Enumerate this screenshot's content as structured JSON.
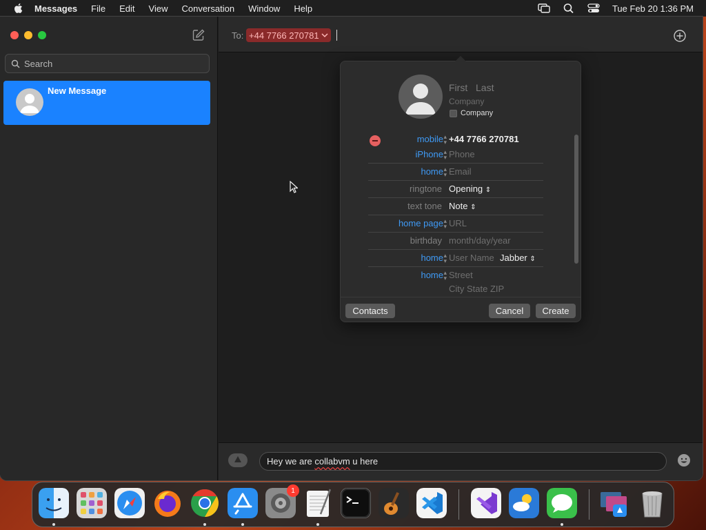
{
  "menubar": {
    "app_name": "Messages",
    "items": [
      "File",
      "Edit",
      "View",
      "Conversation",
      "Window",
      "Help"
    ],
    "datetime": "Tue Feb 20  1:36 PM"
  },
  "sidebar": {
    "search_placeholder": "Search",
    "conversation_title": "New Message"
  },
  "compose": {
    "to_label": "To:",
    "recipient": "+44 7766 270781",
    "message_prefix": "Hey we are ",
    "message_typo": "collabvm",
    "message_suffix": " u here"
  },
  "contact_card": {
    "first_placeholder": "First",
    "last_placeholder": "Last",
    "company_placeholder": "Company",
    "company_checkbox_label": "Company",
    "fields": [
      {
        "label": "mobile",
        "value": "+44 7766 270781"
      },
      {
        "label": "iPhone",
        "value": "Phone"
      },
      {
        "label": "home",
        "value": "Email"
      },
      {
        "label": "ringtone",
        "value": "Opening"
      },
      {
        "label": "text tone",
        "value": "Note"
      },
      {
        "label": "home page",
        "value": "URL"
      },
      {
        "label": "birthday",
        "value": "month/day/year"
      },
      {
        "label": "home",
        "value": "User Name",
        "service": "Jabber"
      },
      {
        "label": "home",
        "value": "Street",
        "value2": "City State ZIP"
      }
    ],
    "buttons": {
      "contacts": "Contacts",
      "cancel": "Cancel",
      "create": "Create"
    }
  },
  "dock": {
    "settings_badge": "1"
  },
  "colors": {
    "accent": "#1a82ff",
    "recipient_bg": "#8a2a2a",
    "field_label_blue": "#3f9af5"
  }
}
